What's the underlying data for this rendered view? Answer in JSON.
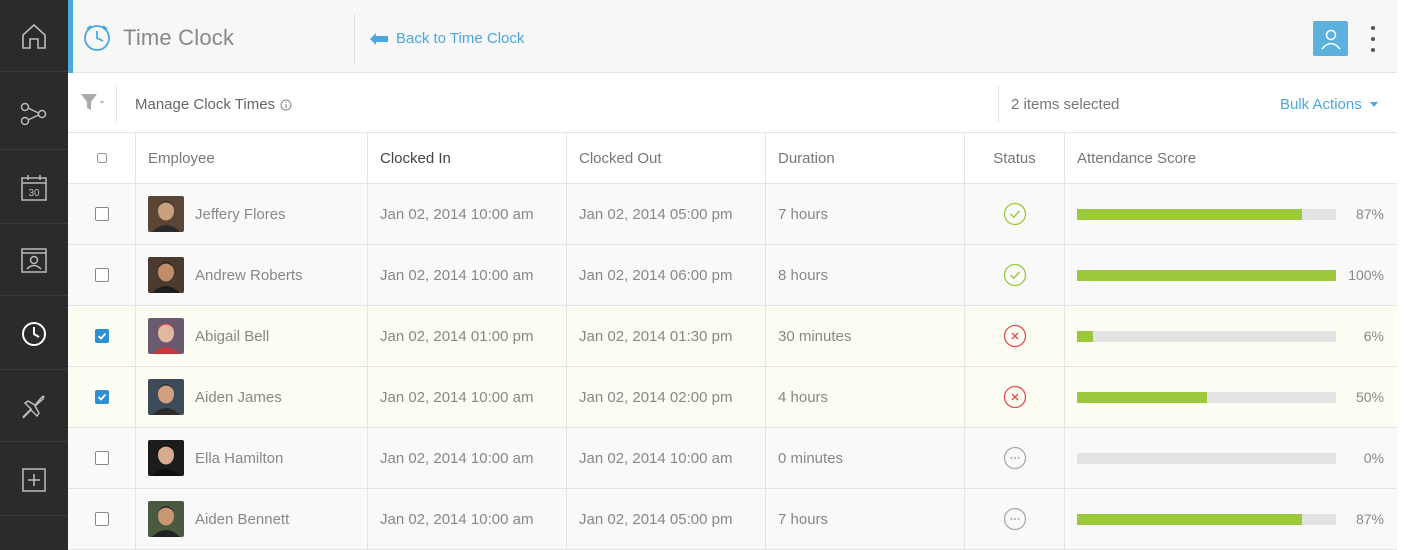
{
  "app": {
    "title": "Time Clock",
    "back_label": "Back to Time Clock"
  },
  "sidebar": {
    "items": [
      {
        "icon": "home-icon"
      },
      {
        "icon": "network-icon"
      },
      {
        "icon": "calendar-icon",
        "badge": "30"
      },
      {
        "icon": "portrait-icon"
      },
      {
        "icon": "clock-icon",
        "active": true
      },
      {
        "icon": "plane-icon"
      },
      {
        "icon": "add-icon"
      }
    ]
  },
  "toolbar": {
    "manage_label": "Manage Clock Times",
    "selected_label": "2 items selected",
    "bulk_label": "Bulk Actions"
  },
  "table": {
    "headers": {
      "employee": "Employee",
      "clocked_in": "Clocked In",
      "clocked_out": "Clocked Out",
      "duration": "Duration",
      "status": "Status",
      "score": "Attendance Score"
    },
    "rows": [
      {
        "name": "Jeffery Flores",
        "in": "Jan 02, 2014 10:00 am",
        "out": "Jan 02, 2014 05:00 pm",
        "duration": "7 hours",
        "status": "ok",
        "score": 87,
        "score_label": "87%",
        "selected": false
      },
      {
        "name": "Andrew Roberts",
        "in": "Jan 02, 2014 10:00 am",
        "out": "Jan 02, 2014 06:00 pm",
        "duration": "8 hours",
        "status": "ok",
        "score": 100,
        "score_label": "100%",
        "selected": false
      },
      {
        "name": "Abigail Bell",
        "in": "Jan 02, 2014 01:00 pm",
        "out": "Jan 02, 2014 01:30 pm",
        "duration": "30 minutes",
        "status": "error",
        "score": 6,
        "score_label": "6%",
        "selected": true
      },
      {
        "name": "Aiden James",
        "in": "Jan 02, 2014 10:00 am",
        "out": "Jan 02, 2014 02:00 pm",
        "duration": "4 hours",
        "status": "error",
        "score": 50,
        "score_label": "50%",
        "selected": true
      },
      {
        "name": "Ella Hamilton",
        "in": "Jan 02, 2014 10:00 am",
        "out": "Jan 02, 2014 10:00 am",
        "duration": "0 minutes",
        "status": "pending",
        "score": 0,
        "score_label": "0%",
        "selected": false
      },
      {
        "name": "Aiden Bennett",
        "in": "Jan 02, 2014 10:00 am",
        "out": "Jan 02, 2014 05:00 pm",
        "duration": "7 hours",
        "status": "pending",
        "score": 87,
        "score_label": "87%",
        "selected": false
      }
    ]
  },
  "colors": {
    "accent": "#4aa7df",
    "ok": "#9cc83b",
    "error": "#e05050",
    "pending": "#aaaaaa",
    "score_fill": "#9cc83b",
    "sidebar_bg": "#2b2b2b"
  }
}
